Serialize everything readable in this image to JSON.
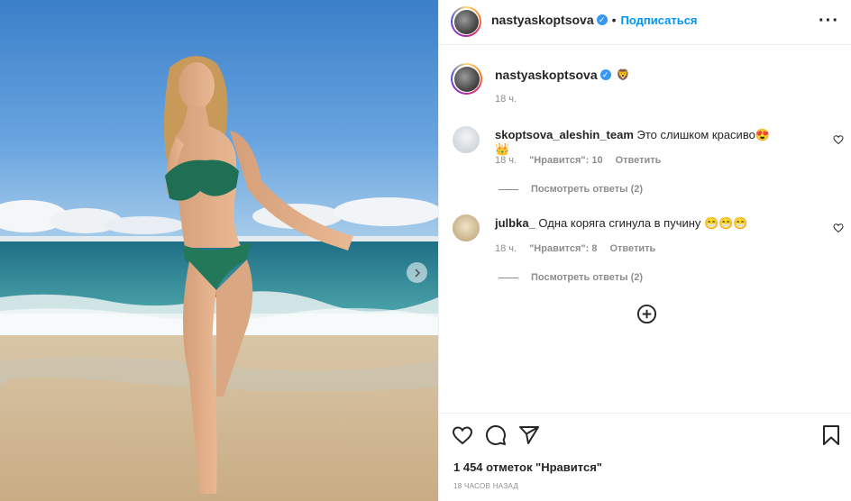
{
  "header": {
    "username": "nastyaskoptsova",
    "separator": "•",
    "follow_label": "Подписаться",
    "more_icon": "more-horizontal-icon"
  },
  "caption": {
    "username": "nastyaskoptsova",
    "text": "🦁",
    "time": "18 ч."
  },
  "comments": [
    {
      "username": "skoptsova_aleshin_team",
      "text": "Это слишком красиво😍👑",
      "time": "18 ч.",
      "likes": "\"Нравится\": 10",
      "reply": "Ответить",
      "view_replies": "Посмотреть ответы (2)"
    },
    {
      "username": "julbka_",
      "text": "Одна коряга сгинула в пучину 😁😁😁",
      "time": "18 ч.",
      "likes": "\"Нравится\": 8",
      "reply": "Ответить",
      "view_replies": "Посмотреть ответы (2)"
    }
  ],
  "load_more_icon": "plus-circle-icon",
  "actions": {
    "icons": [
      "heart-icon",
      "comment-icon",
      "share-icon",
      "bookmark-icon"
    ],
    "likes_text": "1 454 отметок \"Нравится\"",
    "time_ago": "18 ЧАСОВ НАЗАД"
  },
  "colors": {
    "link_blue": "#0095f6",
    "verified_blue": "#3897f0",
    "muted_gray": "#8e8e8e",
    "text": "#262626"
  }
}
